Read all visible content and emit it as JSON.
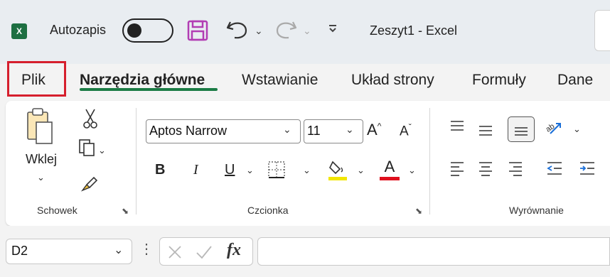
{
  "titlebar": {
    "logo_text": "X",
    "autosave_label": "Autozapis",
    "autosave_state": "off",
    "doc_title": "Zeszyt1  -  Excel"
  },
  "tabs": [
    {
      "label": "Plik",
      "highlighted": true
    },
    {
      "label": "Narzędzia główne",
      "active": true
    },
    {
      "label": "Wstawianie"
    },
    {
      "label": "Układ strony"
    },
    {
      "label": "Formuły"
    },
    {
      "label": "Dane"
    }
  ],
  "ribbon": {
    "clipboard": {
      "paste_label": "Wklej",
      "group_label": "Schowek"
    },
    "font": {
      "font_name": "Aptos Narrow",
      "font_size": "11",
      "bold": "B",
      "italic": "I",
      "underline": "U",
      "font_color_glyph": "A",
      "grow_glyph": "A",
      "shrink_glyph": "A",
      "group_label": "Czcionka",
      "highlight_color": "#f2e600",
      "font_color": "#e0101e"
    },
    "alignment": {
      "group_label": "Wyrównanie"
    }
  },
  "formula_bar": {
    "name_box": "D2",
    "fx": "fx",
    "formula": ""
  },
  "colors": {
    "excel_green": "#1d6f42",
    "active_tab_underline": "#1b7b45",
    "highlight_box": "#d61f2d",
    "save_icon": "#b23db3"
  }
}
